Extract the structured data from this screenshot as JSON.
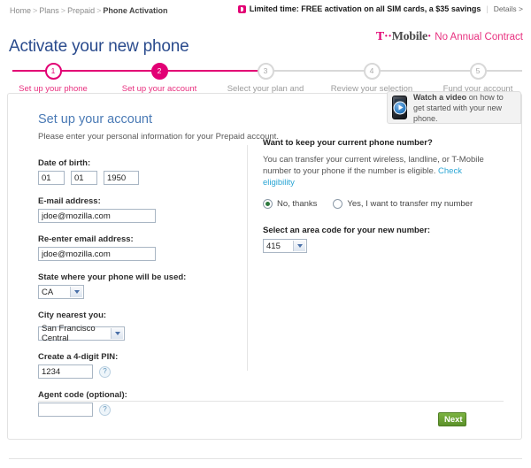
{
  "breadcrumb": {
    "items": [
      "Home",
      "Plans",
      "Prepaid",
      "Phone Activation"
    ],
    "separator": ">"
  },
  "promo": {
    "badge_icon": "tmobile-square-icon",
    "text": "Limited time: FREE activation on all SIM cards, a $35 savings",
    "divider": "|",
    "details_label": "Details >"
  },
  "header": {
    "title": "Activate your new phone",
    "logo_text": "T··Mobile·",
    "logo_tagline": "No Annual Contract"
  },
  "stepper": {
    "steps": [
      {
        "number": "1",
        "label": "Set up your phone",
        "state": "done"
      },
      {
        "number": "2",
        "label": "Set up your account",
        "state": "active"
      },
      {
        "number": "3",
        "label": "Select your plan and services",
        "state": "upcoming"
      },
      {
        "number": "4",
        "label": "Review your selection",
        "state": "upcoming"
      },
      {
        "number": "5",
        "label": "Fund your account",
        "state": "upcoming"
      }
    ]
  },
  "video_promo": {
    "icon": "phone-play-video-icon",
    "lead": "Watch a video",
    "rest": " on how to get started with your new phone."
  },
  "form": {
    "title": "Set up your account",
    "subtitle": "Please enter your personal information for your Prepaid account.",
    "date_of_birth": {
      "label": "Date of birth:",
      "month": "01",
      "day": "01",
      "year": "1950"
    },
    "email": {
      "label": "E-mail address:",
      "value": "jdoe@mozilla.com"
    },
    "email_confirm": {
      "label": "Re-enter email address:",
      "value": "jdoe@mozilla.com"
    },
    "state": {
      "label": "State where your phone will be used:",
      "value": "CA"
    },
    "city": {
      "label": "City nearest you:",
      "value": "San Francisco Central"
    },
    "pin": {
      "label": "Create a 4-digit PIN:",
      "value": "1234",
      "help_icon": "question-mark-icon"
    },
    "agent_code": {
      "label": "Agent code (optional):",
      "value": "",
      "help_icon": "question-mark-icon"
    }
  },
  "transfer": {
    "title": "Want to keep your current phone number?",
    "description": "You can transfer your current wireless, landline, or T-Mobile number to your phone if the number is eligible. ",
    "link_label": "Check eligibility",
    "option_no": "No, thanks",
    "option_yes": "Yes, I want to transfer my number",
    "selected": "no",
    "area_code_label": "Select an area code for your new number:",
    "area_code_value": "415"
  },
  "actions": {
    "next_label": "Next"
  },
  "colors": {
    "magenta": "#e20074",
    "title_blue": "#2a4b8d",
    "link_blue": "#29a5d4",
    "green": "#5b9029"
  }
}
